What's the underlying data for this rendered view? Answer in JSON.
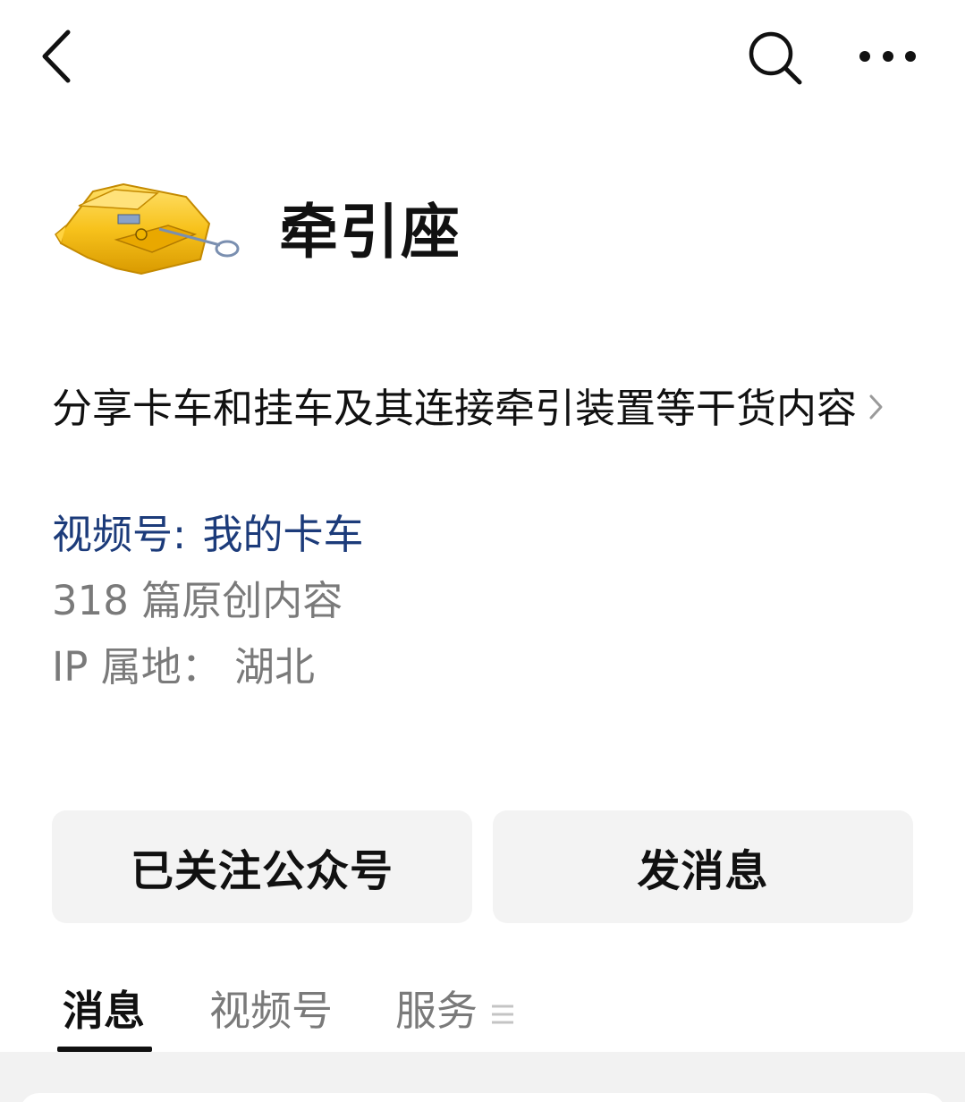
{
  "account": {
    "name": "牵引座",
    "description": "分享卡车和挂车及其连接牵引装置等干货内容",
    "channel_prefix": "视频号:",
    "channel_name": "我的卡车",
    "original_count": "318 篇原创内容",
    "ip_location": "IP 属地： 湖北"
  },
  "actions": {
    "follow_label": "已关注公众号",
    "message_label": "发消息"
  },
  "tabs": [
    {
      "label": "消息",
      "active": true
    },
    {
      "label": "视频号",
      "active": false
    },
    {
      "label": "服务",
      "active": false
    }
  ],
  "icons": {
    "back": "chevron-left-icon",
    "search": "search-icon",
    "more": "more-horizontal-icon",
    "desc_more": "chevron-right-icon",
    "tab_menu": "menu-icon"
  },
  "colors": {
    "channel_link": "#1c3b7a",
    "secondary_text": "#7a7a7a",
    "button_bg": "#f3f3f3",
    "avatar_yellow": "#f7c21c"
  }
}
